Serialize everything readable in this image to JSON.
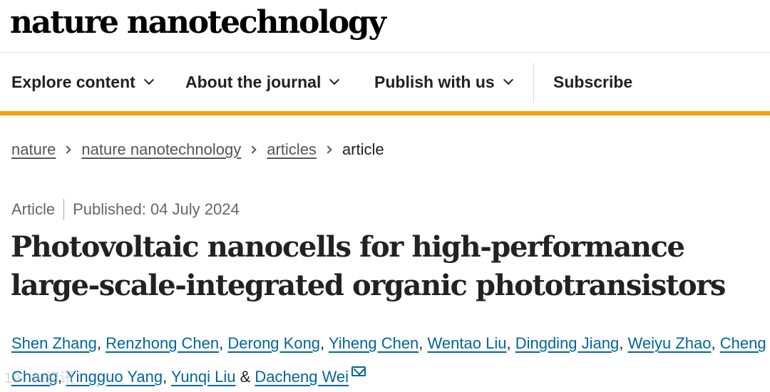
{
  "site": {
    "logo": "nature nanotechnology"
  },
  "nav": {
    "items": [
      {
        "label": "Explore content",
        "dropdown": true
      },
      {
        "label": "About the journal",
        "dropdown": true
      },
      {
        "label": "Publish with us",
        "dropdown": true
      },
      {
        "label": "Subscribe",
        "dropdown": false
      }
    ],
    "accent_color": "#f0a30a"
  },
  "breadcrumb": {
    "items": [
      "nature",
      "nature nanotechnology",
      "articles"
    ],
    "current": "article"
  },
  "article": {
    "type": "Article",
    "published": "Published: 04 July 2024",
    "title": "Photovoltaic nanocells for high-performance large-scale-integrated organic phototransistors",
    "authors": [
      "Shen Zhang",
      "Renzhong Chen",
      "Derong Kong",
      "Yiheng Chen",
      "Wentao Liu",
      "Dingding Jiang",
      "Weiyu Zhao",
      "Cheng Chang",
      "Yingguo Yang",
      "Yunqi Liu",
      "Dacheng Wei"
    ],
    "author_separator": ",",
    "final_separator": "&",
    "contact_icon": "mail-icon",
    "link_color": "#006699"
  },
  "watermark": "19 · AI资讯"
}
